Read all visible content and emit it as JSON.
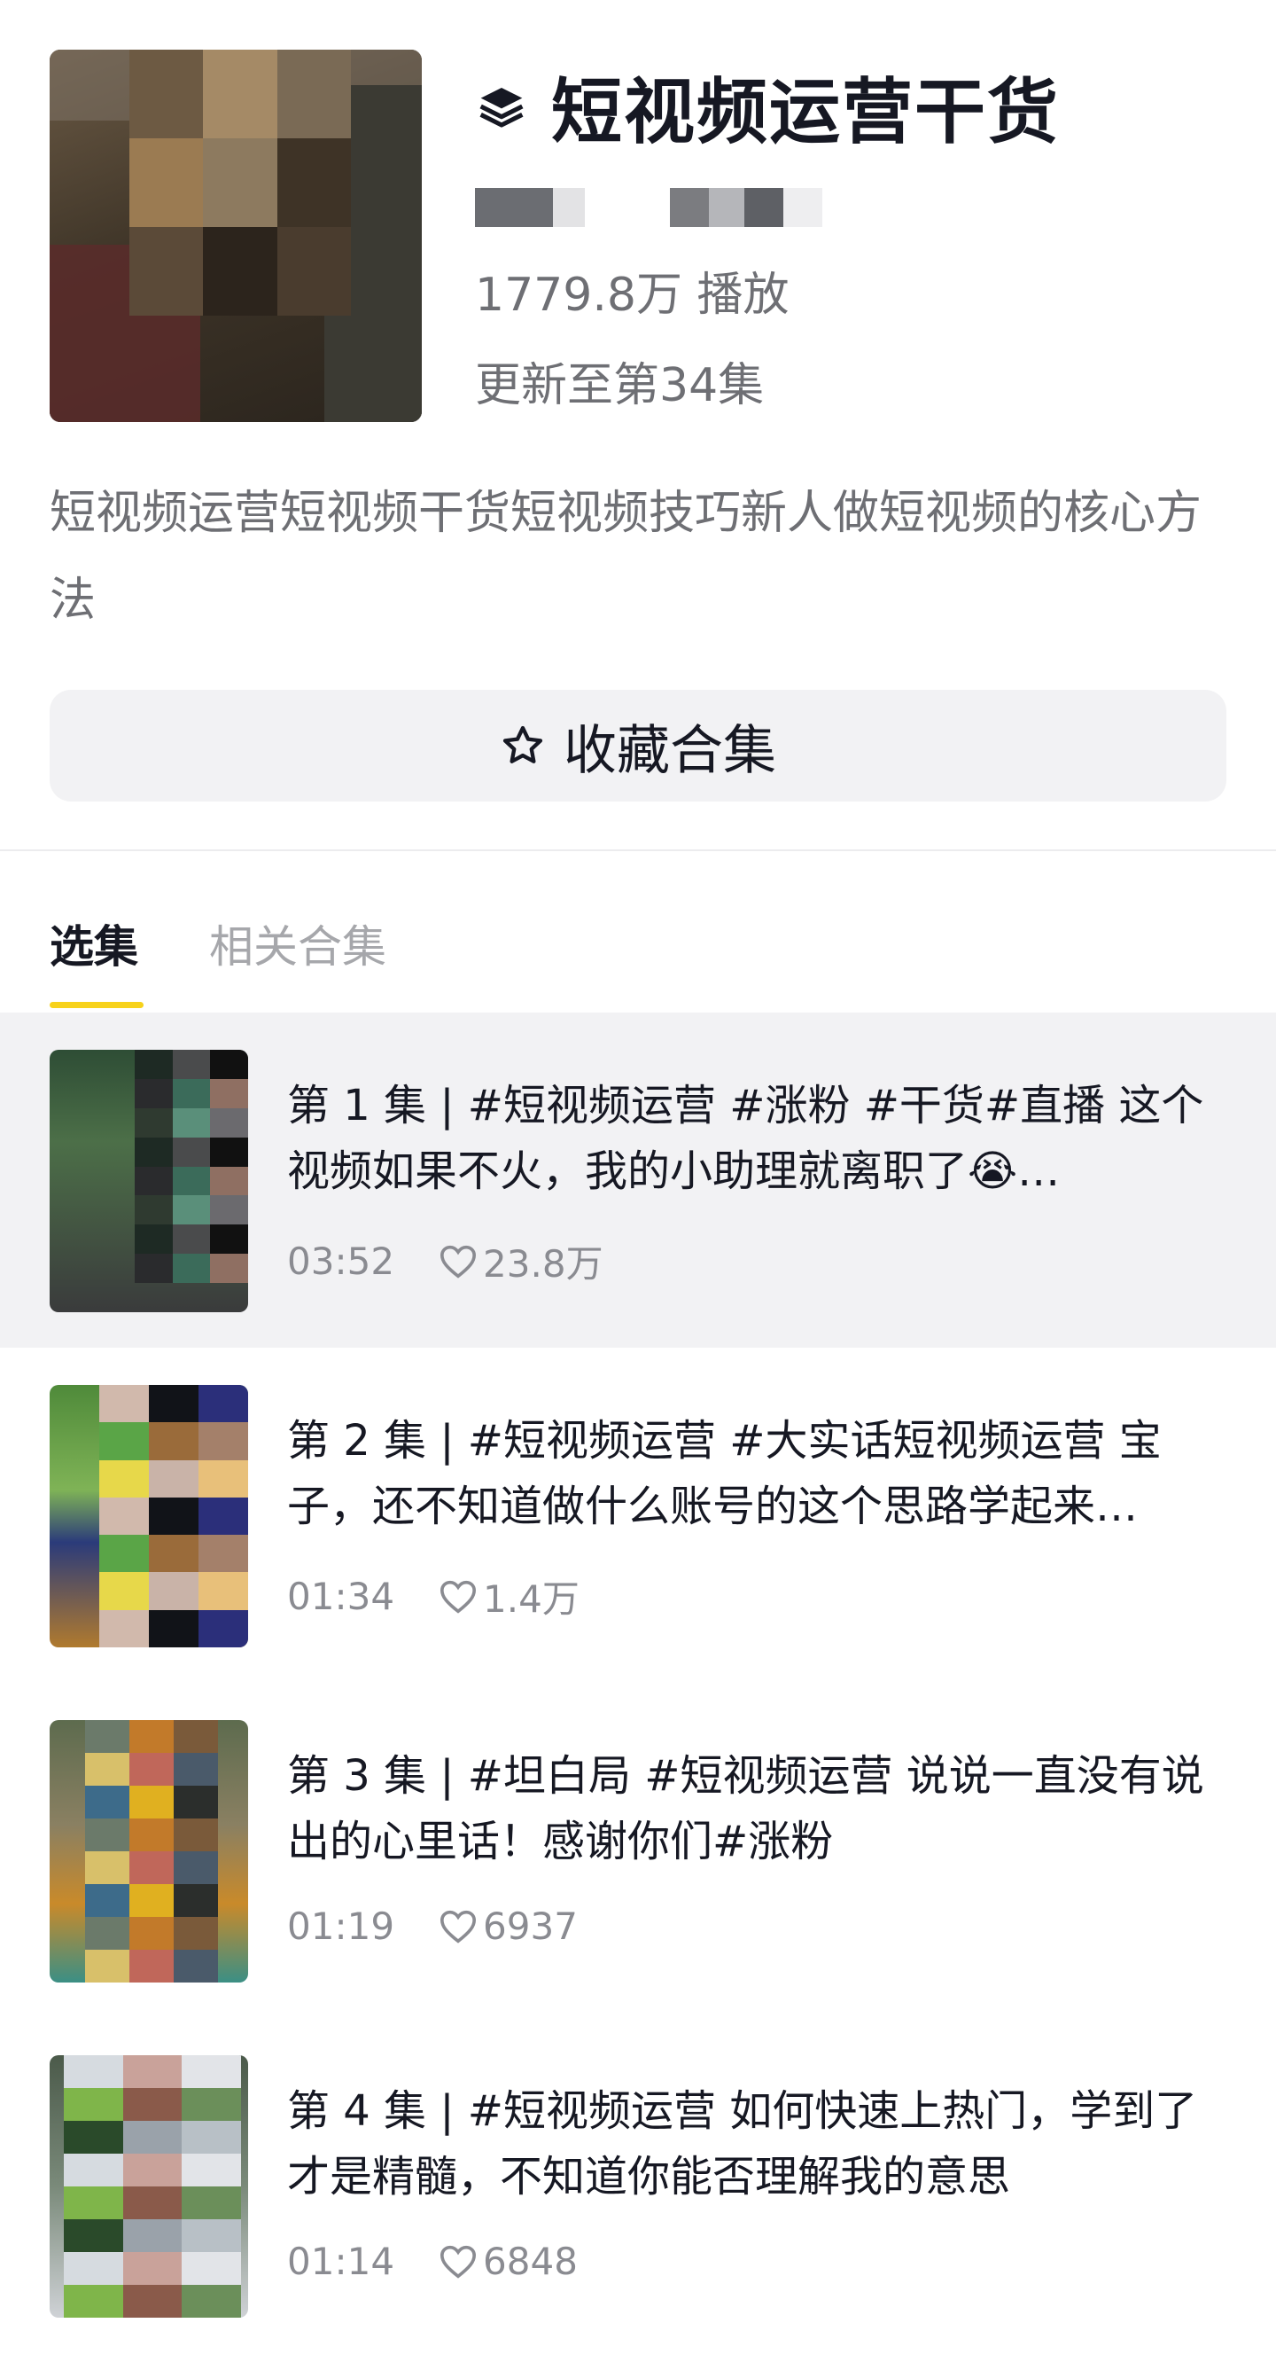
{
  "collection": {
    "title": "短视频运营干货",
    "plays": "1779.8万 播放",
    "update": "更新至第34集",
    "description": "短视频运营短视频干货短视频技巧新人做短视频的核心方法",
    "collect_label": "收藏合集"
  },
  "tabs": [
    {
      "label": "选集",
      "active": true
    },
    {
      "label": "相关合集",
      "active": false
    }
  ],
  "episodes": [
    {
      "title": "第 1 集 | #短视频运营 #涨粉 #干货#直播 这个视频如果不火，我的小助理就离职了😭…",
      "duration": "03:52",
      "likes": "23.8万",
      "selected": true
    },
    {
      "title": "第 2 集 | #短视频运营 #大实话短视频运营 宝子，还不知道做什么账号的这个思路学起来…",
      "duration": "01:34",
      "likes": "1.4万",
      "selected": false
    },
    {
      "title": "第 3 集 | #坦白局 #短视频运营 说说一直没有说出的心里话！感谢你们#涨粉",
      "duration": "01:19",
      "likes": "6937",
      "selected": false
    },
    {
      "title": "第 4 集 | #短视频运营 如何快速上热门，学到了才是精髓，不知道你能否理解我的意思",
      "duration": "01:14",
      "likes": "6848",
      "selected": false
    }
  ],
  "icons": {
    "collection": "stack-icon",
    "collect": "star-outline-icon",
    "like": "heart-outline-icon"
  },
  "colors": {
    "accent_underline": "#f7d21b",
    "selected_row_bg": "#f2f2f4",
    "secondary_text": "#6e6f74"
  }
}
